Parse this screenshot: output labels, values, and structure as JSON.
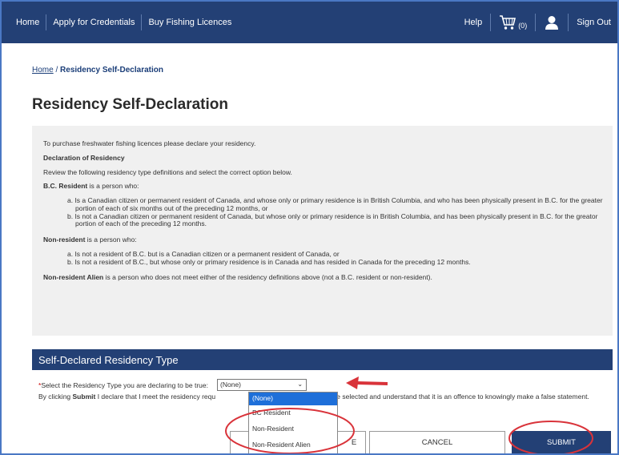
{
  "nav": {
    "links": [
      "Home",
      "Apply for Credentials",
      "Buy Fishing Licences"
    ],
    "help": "Help",
    "cart_count": "(0)",
    "sign_out": "Sign Out"
  },
  "breadcrumb": {
    "home": "Home",
    "separator": " / ",
    "current": "Residency Self-Declaration"
  },
  "page_title": "Residency Self-Declaration",
  "info": {
    "intro": "To purchase freshwater fishing licences please declare your residency.",
    "heading": "Declaration of Residency",
    "review": "Review the following residency type definitions and select the correct option below.",
    "bc_term": "B.C. Resident",
    "bc_rest": " is a person who:",
    "bc_a": "a. Is a Canadian citizen or permanent resident of Canada, and whose only or primary residence is in British Columbia, and who has been physically present in B.C. for the greater portion of each of six months out of the preceding 12 months, or",
    "bc_b": "b. Is not a Canadian citizen or permanent resident of Canada, but whose only or primary residence is in British Columbia, and has been physically present in B.C. for the greator portion of each of the preceding 12 months.",
    "nr_term": "Non-resident",
    "nr_rest": " is a person who:",
    "nr_a": "a. Is not a resident of B.C. but is a Canadian citizen or a permanent resident of Canada, or",
    "nr_b": "b. Is not a resident of B.C., but whose only or primary residence is in Canada and has resided in Canada for the preceding 12 months.",
    "alien_term": "Non-resident Alien",
    "alien_rest": " is a person who does not meet either of the residency definitions above (not a B.C. resident or non-resident)."
  },
  "section_title": "Self-Declared Residency Type",
  "select": {
    "required_mark": "*",
    "label": "Select the Residency Type you are declaring to be true:",
    "value": "(None)",
    "options": [
      "(None)",
      "BC Resident",
      "Non-Resident",
      "Non-Resident Alien"
    ]
  },
  "declaration": {
    "prefix": "By clicking ",
    "bold": "Submit",
    "start": " I declare that I meet the residency requ",
    "end": "cy type selected and understand that it is an offence to knowingly make a false statement."
  },
  "buttons": {
    "back_partial": "E",
    "cancel": "CANCEL",
    "submit": "SUBMIT"
  },
  "annotation_color": "#d9333a"
}
